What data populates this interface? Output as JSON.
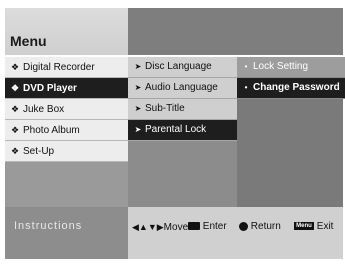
{
  "header": {
    "title": "Menu"
  },
  "col1": [
    {
      "label": "Digital Recorder",
      "icon": "diamond-icon"
    },
    {
      "label": "DVD Player",
      "icon": "diamond-icon",
      "selected": true
    },
    {
      "label": "Juke Box",
      "icon": "diamond-icon"
    },
    {
      "label": "Photo Album",
      "icon": "diamond-icon"
    },
    {
      "label": "Set-Up",
      "icon": "diamond-icon"
    }
  ],
  "col2": [
    {
      "label": "Disc Language",
      "icon": "arrow-icon"
    },
    {
      "label": "Audio Language",
      "icon": "arrow-icon"
    },
    {
      "label": "Sub-Title",
      "icon": "arrow-icon"
    },
    {
      "label": "Parental Lock",
      "icon": "arrow-icon",
      "selected": true
    }
  ],
  "col3": [
    {
      "label": "Lock Setting",
      "icon": "bullet-icon"
    },
    {
      "label": "Change Password",
      "icon": "bullet-icon",
      "selected": true
    }
  ],
  "instructions": {
    "label": "Instructions",
    "move": "Move",
    "enter": "Enter",
    "return": "Return",
    "menu_key": "Menu",
    "exit": "Exit"
  }
}
